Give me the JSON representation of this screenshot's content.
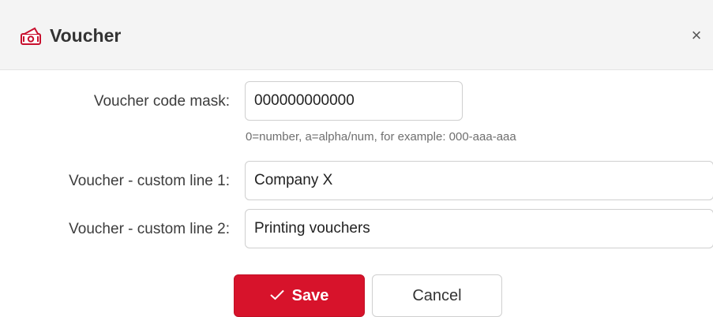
{
  "dialog": {
    "title": "Voucher",
    "title_icon": "voucher-ticket-icon",
    "close_label": "×",
    "accent_color": "#d7132b"
  },
  "form": {
    "code_mask_label": "Voucher code mask:",
    "code_mask_value": "000000000000",
    "code_mask_hint": "0=number, a=alpha/num, for example: 000-aaa-aaa",
    "custom_line_1_label": "Voucher - custom line 1:",
    "custom_line_1_value": "Company X",
    "custom_line_2_label": "Voucher - custom line 2:",
    "custom_line_2_value": "Printing vouchers"
  },
  "actions": {
    "save_label": "Save",
    "save_icon": "check-icon",
    "cancel_label": "Cancel"
  }
}
